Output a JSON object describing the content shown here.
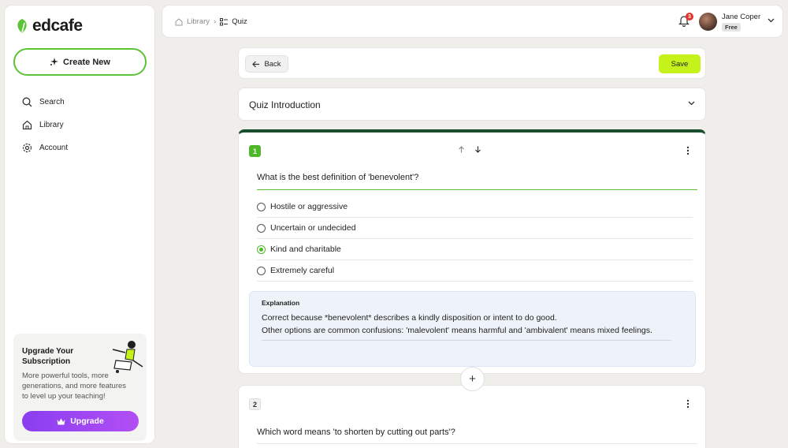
{
  "app": {
    "name": "edcafe"
  },
  "sidebar": {
    "create_label": "Create New",
    "nav": [
      {
        "label": "Search",
        "icon": "search-icon"
      },
      {
        "label": "Library",
        "icon": "home-icon"
      },
      {
        "label": "Account",
        "icon": "gear-icon"
      }
    ],
    "upgrade": {
      "title": "Upgrade Your Subscription",
      "description": "More powerful tools, more generations, and more features to level up your teaching!",
      "button_label": "Upgrade"
    }
  },
  "topbar": {
    "breadcrumb": {
      "parent": "Library",
      "current": "Quiz"
    },
    "notifications_count": "3",
    "user": {
      "name": "Jane Coper",
      "plan": "Free"
    }
  },
  "header": {
    "back_label": "Back",
    "save_label": "Save"
  },
  "intro": {
    "title": "Quiz Introduction"
  },
  "question1": {
    "number": "1",
    "text": "What is the best definition of 'benevolent'?",
    "options": [
      {
        "label": "Hostile or aggressive",
        "selected": false
      },
      {
        "label": "Uncertain or undecided",
        "selected": false
      },
      {
        "label": "Kind and charitable",
        "selected": true
      },
      {
        "label": "Extremely careful",
        "selected": false
      }
    ],
    "explanation_title": "Explanation",
    "explanation_line1": "Correct because *benevolent* describes a kindly disposition or intent to do good.",
    "explanation_line2": "Other options are common confusions: 'malevolent' means harmful and 'ambivalent' means mixed feelings."
  },
  "add_label": "+",
  "question2": {
    "number": "2",
    "text": "Which word means 'to shorten by cutting out parts'?"
  },
  "colors": {
    "accent": "#4fb829",
    "save": "#c5f21b",
    "upgrade": "#8a3ef0",
    "question_border": "#1a4d2e"
  }
}
